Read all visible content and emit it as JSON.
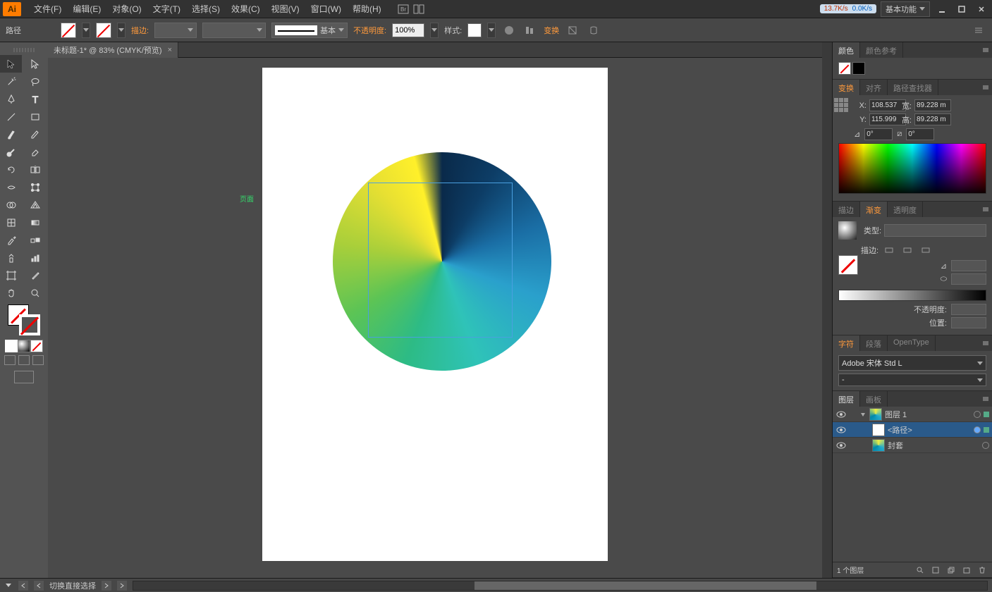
{
  "menu": {
    "items": [
      "文件(F)",
      "编辑(E)",
      "对象(O)",
      "文字(T)",
      "选择(S)",
      "效果(C)",
      "视图(V)",
      "窗口(W)",
      "帮助(H)"
    ]
  },
  "workspace": {
    "label": "基本功能"
  },
  "net": {
    "down": "13.7K/s",
    "up": "0.0K/s"
  },
  "control": {
    "path_label": "路径",
    "stroke_label": "描边:",
    "stroke_style": "基本",
    "opacity_label": "不透明度:",
    "opacity_value": "100%",
    "style_label": "样式:",
    "transform_label": "变换"
  },
  "tab": {
    "title": "未标题-1* @ 83% (CMYK/预览)"
  },
  "canvas": {
    "page_label": "页面"
  },
  "panels": {
    "color": {
      "tab1": "颜色",
      "tab2": "颜色参考"
    },
    "transform": {
      "tab1": "变换",
      "tab2": "对齐",
      "tab3": "路径查找器",
      "x_lbl": "X:",
      "x_val": "108.537",
      "y_lbl": "Y:",
      "y_val": "115.999",
      "w_lbl": "宽:",
      "w_val": "89.228 m",
      "h_lbl": "高:",
      "h_val": "89.228 m",
      "rot_val": "0°",
      "shear_val": "0°"
    },
    "gradient": {
      "tab1": "描边",
      "tab2": "渐变",
      "tab3": "透明度",
      "type_lbl": "类型:",
      "stroke_lbl": "描边:",
      "opacity_lbl": "不透明度:",
      "position_lbl": "位置:"
    },
    "char": {
      "tab1": "字符",
      "tab2": "段落",
      "tab3": "OpenType",
      "font": "Adobe 宋体 Std L",
      "style": "-"
    },
    "layers": {
      "tab1": "图层",
      "tab2": "画板",
      "rows": [
        {
          "name": "图层 1"
        },
        {
          "name": "<路径>"
        },
        {
          "name": "封套"
        }
      ],
      "count": "1 个图层"
    }
  },
  "status": {
    "hint": "切换直接选择"
  }
}
